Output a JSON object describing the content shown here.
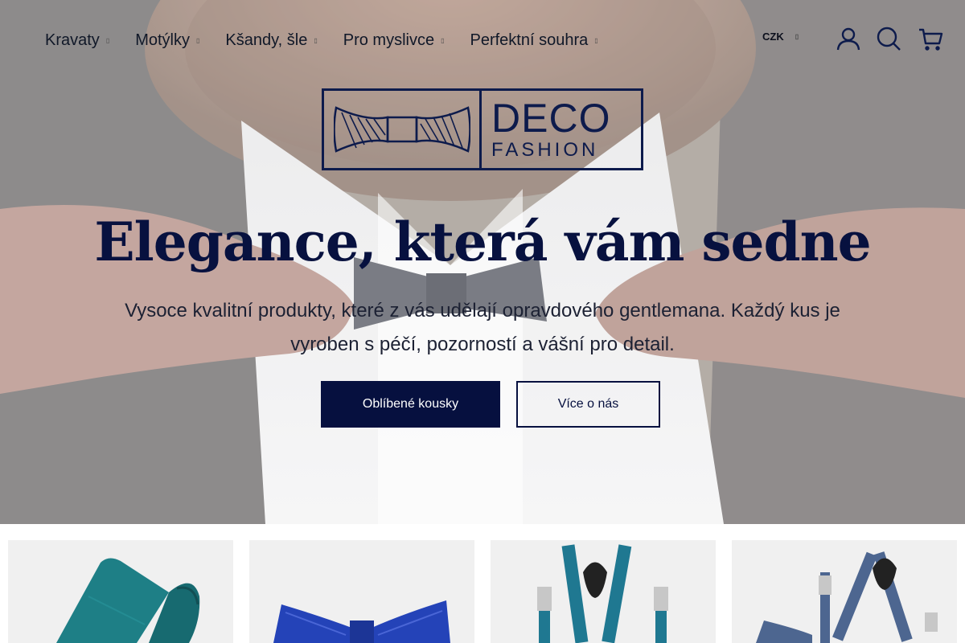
{
  "nav": {
    "items": [
      {
        "label": "Kravaty"
      },
      {
        "label": "Motýlky"
      },
      {
        "label": "Kšandy, šle"
      },
      {
        "label": "Pro myslivce"
      },
      {
        "label": "Perfektní souhra"
      }
    ],
    "caret_glyph": "▯"
  },
  "header": {
    "currency": "CZK",
    "icons": [
      "user-icon",
      "search-icon",
      "cart-icon"
    ]
  },
  "logo": {
    "line1": "DECO",
    "line2": "FASHION"
  },
  "hero": {
    "headline": "Elegance, která vám sedne",
    "subline": "Vysoce kvalitní produkty, které z vás udělají opravdového gentlemana. Každý kus je vyroben s péčí, pozorností a vášní pro detail.",
    "primary_button": "Oblíbené kousky",
    "secondary_button": "Více o nás"
  },
  "tiles": [
    {
      "product": "tie",
      "color": "#1e7f86"
    },
    {
      "product": "bow-tie",
      "color": "#2443b8"
    },
    {
      "product": "suspenders",
      "color": "#1f7891"
    },
    {
      "product": "suspenders-bow-tie-set",
      "color": "#4d6690"
    }
  ],
  "colors": {
    "brand_navy": "#06103f",
    "logo_navy": "#0d1b4c"
  }
}
